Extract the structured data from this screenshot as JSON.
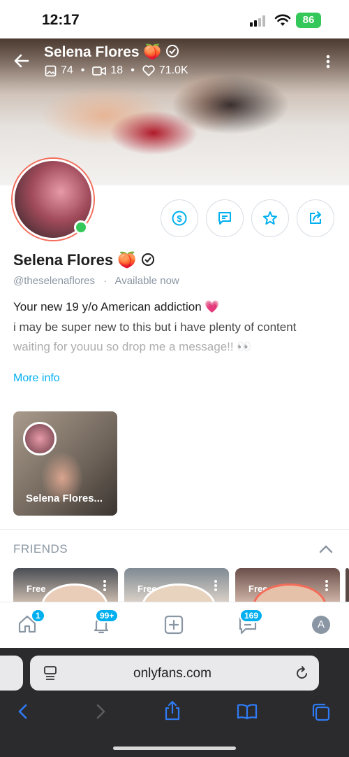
{
  "status": {
    "time": "12:17",
    "battery": "86"
  },
  "header": {
    "name": "Selena Flores 🍑",
    "stats": {
      "photos": "74",
      "videos": "18",
      "likes": "71.0K"
    }
  },
  "profile": {
    "name": "Selena Flores 🍑",
    "handle": "@theselenaflores",
    "availability": "Available now",
    "bio": [
      "Your new 19 y/o American addiction 💗",
      "i may be super new to this but i have plenty of content",
      "waiting for youuu so drop me a message!! 👀"
    ],
    "more_info": "More info"
  },
  "story": {
    "label": "Selena Flores..."
  },
  "friends": {
    "heading": "FRIENDS",
    "cards": [
      {
        "tag": "Free"
      },
      {
        "tag": "Free"
      },
      {
        "tag": "Free"
      }
    ]
  },
  "nav": {
    "home_badge": "1",
    "notifications_badge": "99+",
    "messages_badge": "169",
    "avatar_letter": "A"
  },
  "browser": {
    "url": "onlyfans.com"
  },
  "colors": {
    "accent": "#00aff0",
    "online": "#34c759"
  }
}
